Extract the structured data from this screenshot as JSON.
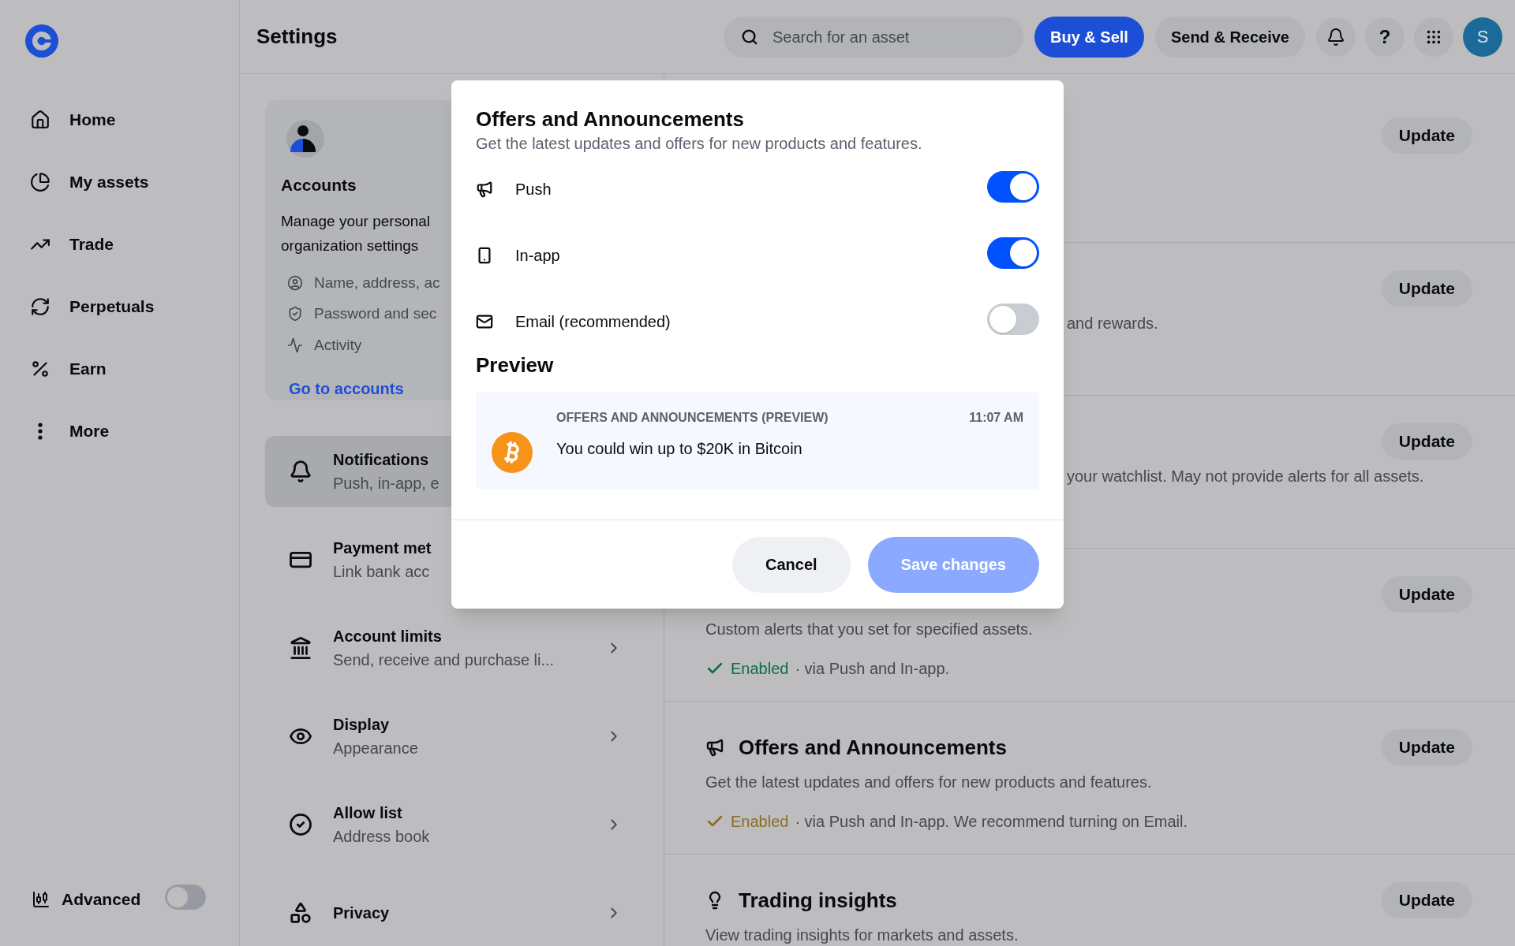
{
  "sidebar": {
    "items": [
      {
        "kind": "home",
        "label": "Home"
      },
      {
        "kind": "assets",
        "label": "My assets"
      },
      {
        "kind": "trade",
        "label": "Trade"
      },
      {
        "kind": "perpetuals",
        "label": "Perpetuals"
      },
      {
        "kind": "earn",
        "label": "Earn"
      },
      {
        "kind": "more",
        "label": "More"
      }
    ],
    "advanced": {
      "label": "Advanced",
      "on": false
    }
  },
  "header": {
    "title": "Settings",
    "search": {
      "placeholder": "Search for an asset"
    },
    "buttons": [
      {
        "label": "Buy & Sell",
        "primary": true
      },
      {
        "label": "Send & Receive",
        "primary": false
      }
    ],
    "help_button": "?",
    "avatar": "S"
  },
  "accounts_card": {
    "title": "Accounts",
    "description_lines": [
      "Manage your personal",
      "organization settings"
    ],
    "items": [
      {
        "kind": "person",
        "label": "Name, address, ac"
      },
      {
        "kind": "shield",
        "label": "Password and sec"
      },
      {
        "kind": "activity",
        "label": "Activity"
      }
    ],
    "link": "Go to accounts"
  },
  "settings_menu": [
    {
      "kind": "bell",
      "title": "Notifications",
      "subtitle": "Push, in-app, e",
      "selected": true
    },
    {
      "kind": "card",
      "title": "Payment met",
      "subtitle": "Link bank acc",
      "selected": false
    },
    {
      "kind": "bank",
      "title": "Account limits",
      "subtitle": "Send, receive and purchase li...",
      "selected": false,
      "chevron": true
    },
    {
      "kind": "eye",
      "title": "Display",
      "subtitle": "Appearance",
      "selected": false,
      "chevron": true
    },
    {
      "kind": "check",
      "title": "Allow list",
      "subtitle": "Address book",
      "selected": false,
      "chevron": true
    },
    {
      "kind": "shapes",
      "title": "Privacy",
      "selected": false,
      "chevron": true
    }
  ],
  "notification_sections": [
    {
      "update": "Update"
    },
    {
      "description": "and rewards.",
      "covered": true,
      "update": "Update"
    },
    {
      "description": "your watchlist. May not provide alerts for all assets.",
      "covered": true,
      "update": "Update"
    },
    {
      "description": "Custom alerts that you set for specified assets.",
      "status": {
        "label": "Enabled",
        "detail": "· via Push and In-app.",
        "color": "#0b6e45"
      },
      "update": "Update"
    },
    {
      "kind": "megaphone",
      "title": "Offers and Announcements",
      "description": "Get the latest updates and offers for new products and features.",
      "status": {
        "label": "Enabled",
        "detail": "· via Push and In-app. We recommend turning on Email.",
        "color": "#8f6b25"
      },
      "update": "Update"
    },
    {
      "kind": "bulb",
      "title": "Trading insights",
      "description": "View trading insights for markets and assets.",
      "update": "Update"
    }
  ],
  "modal": {
    "title": "Offers and Announcements",
    "subtitle": "Get the latest updates and offers for new products and features.",
    "channels": [
      {
        "kind": "push",
        "label": "Push",
        "on": true
      },
      {
        "kind": "inapp",
        "label": "In-app",
        "on": true
      },
      {
        "kind": "email",
        "label": "Email (recommended)",
        "on": false
      }
    ],
    "preview_heading": "Preview",
    "preview": {
      "category": "OFFERS AND ANNOUNCEMENTS (PREVIEW)",
      "time": "11:07 AM",
      "message": "You could win up to $20K in Bitcoin"
    },
    "buttons": [
      {
        "label": "Cancel",
        "primary": false,
        "disabled": false
      },
      {
        "label": "Save changes",
        "primary": true,
        "disabled": true
      }
    ]
  }
}
